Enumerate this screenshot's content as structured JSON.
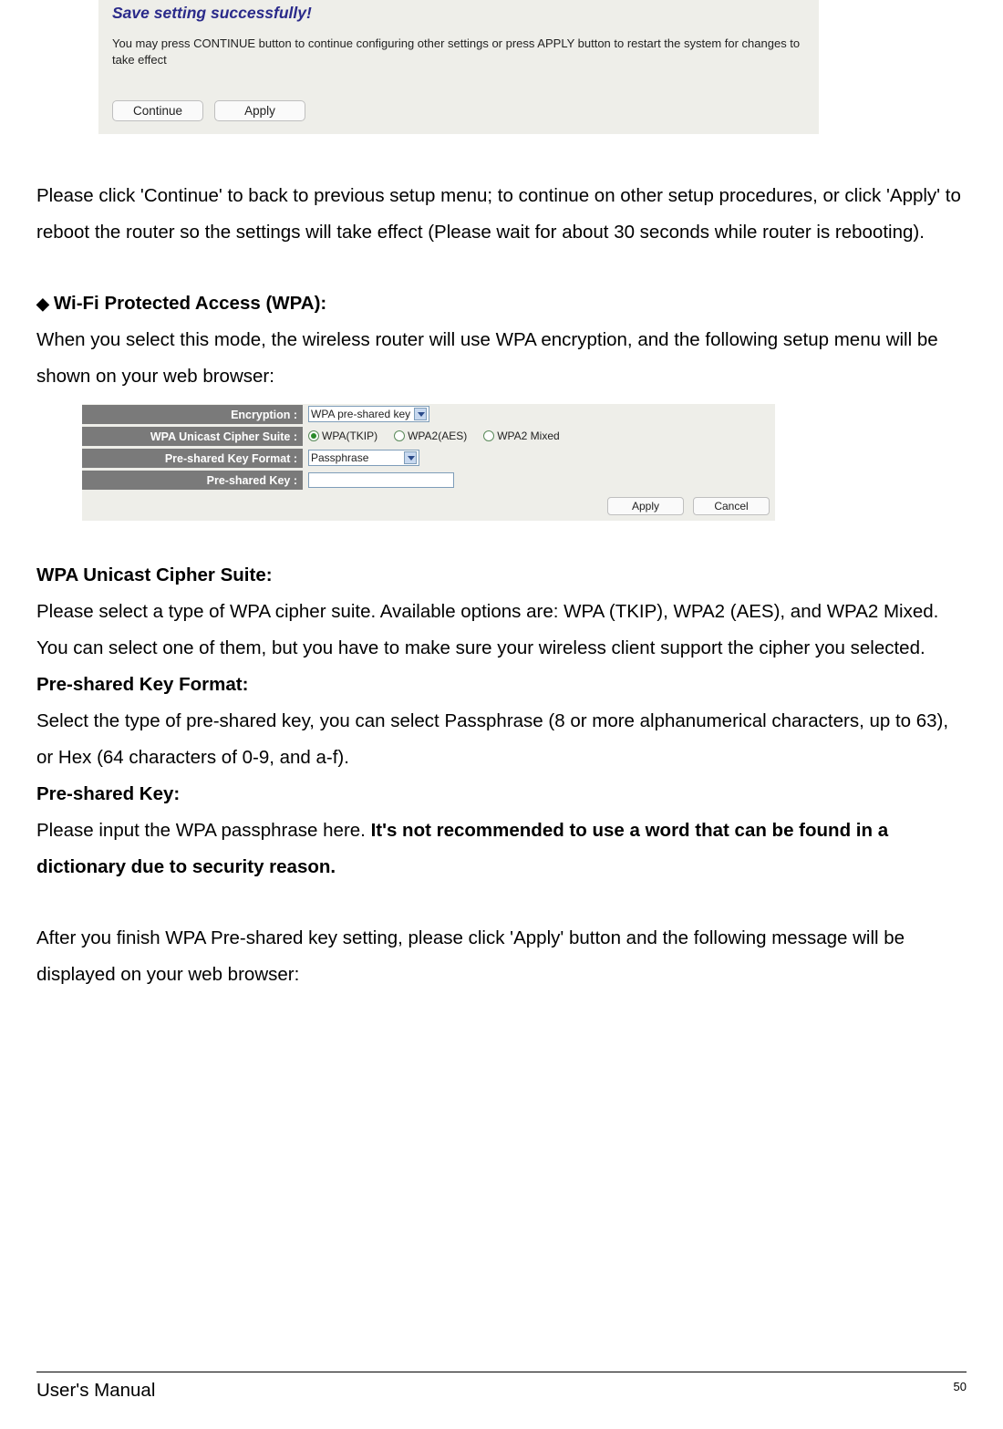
{
  "save_box": {
    "title": "Save setting successfully!",
    "description": "You may press CONTINUE button to continue configuring other settings or press APPLY button to restart the system for changes to take effect",
    "continue_btn": "Continue",
    "apply_btn": "Apply"
  },
  "paragraph_after_save": "Please click 'Continue' to back to previous setup menu; to continue on other setup procedures, or click 'Apply' to reboot the router so the settings will take effect (Please wait for about 30 seconds while router is rebooting).",
  "section_header": "Wi-Fi Protected Access (WPA):",
  "section_intro": "When you select this mode, the wireless router will use WPA encryption, and the following setup menu will be shown on your web browser:",
  "wpa_table": {
    "rows": {
      "encryption": {
        "label": "Encryption :",
        "value": "WPA pre-shared key"
      },
      "cipher": {
        "label": "WPA Unicast Cipher Suite :",
        "options": [
          "WPA(TKIP)",
          "WPA2(AES)",
          "WPA2 Mixed"
        ],
        "selected": 0
      },
      "format": {
        "label": "Pre-shared Key Format :",
        "value": "Passphrase"
      },
      "key": {
        "label": "Pre-shared Key :",
        "value": ""
      }
    },
    "apply_btn": "Apply",
    "cancel_btn": "Cancel"
  },
  "definitions": {
    "cipher_term": "WPA Unicast Cipher Suite:",
    "cipher_desc": "Please select a type of WPA cipher suite. Available options are: WPA (TKIP), WPA2 (AES), and WPA2 Mixed. You can select one of them, but you have to make sure your wireless client support the cipher you selected.",
    "format_term": "Pre-shared Key Format:",
    "format_desc": "Select the type of pre-shared key, you can select Passphrase (8 or more alphanumerical characters, up to 63), or Hex (64 characters of 0-9, and a-f).",
    "key_term": "Pre-shared Key:",
    "key_desc_prefix": "Please input the WPA passphrase here. ",
    "key_desc_bold": "It's not recommended to use a word that can be found in a dictionary due to security reason."
  },
  "paragraph_after_defs": "After you finish WPA Pre-shared key setting, please click 'Apply' button and the following message will be displayed on your web browser:",
  "footer": {
    "title": "User's Manual",
    "page": "50"
  }
}
